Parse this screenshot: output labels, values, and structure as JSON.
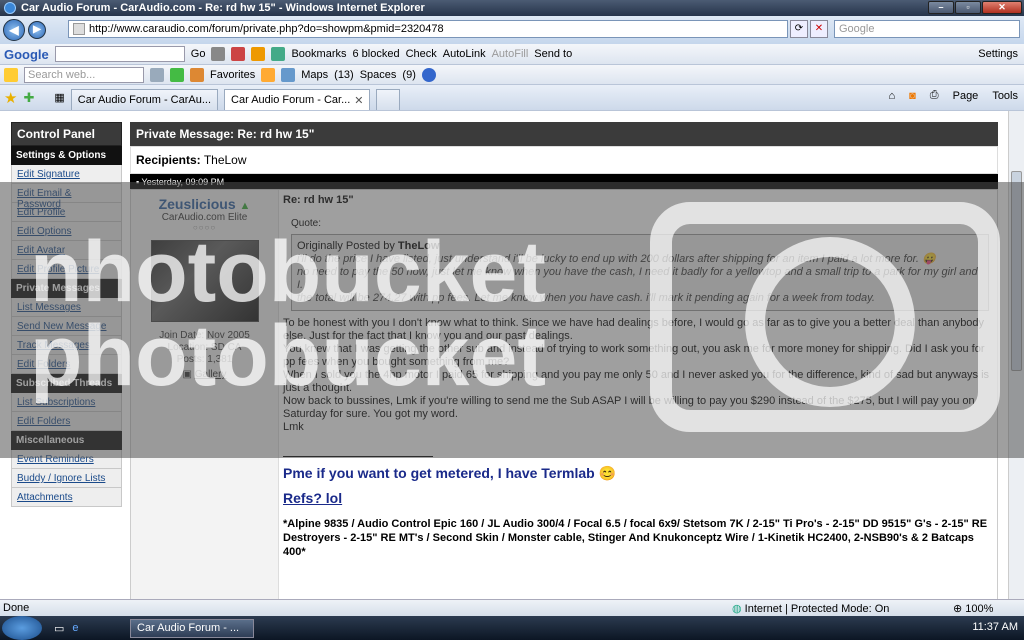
{
  "window": {
    "title": "Car Audio Forum - CarAudio.com - Re: rd hw 15\" - Windows Internet Explorer"
  },
  "address": {
    "url": "http://www.caraudio.com/forum/private.php?do=showpm&pmid=2320478",
    "search_placeholder": "Google"
  },
  "google_bar": {
    "brand": "Google",
    "go": "Go",
    "bookmarks": "Bookmarks",
    "blocked": "6 blocked",
    "check": "Check",
    "autolink": "AutoLink",
    "autofill": "AutoFill",
    "send_to": "Send to",
    "settings": "Settings"
  },
  "live_bar": {
    "search_placeholder": "Search web...",
    "favorites": "Favorites",
    "maps": "Maps",
    "mail_count": "(13)",
    "spaces": "Spaces",
    "msgr_count": "(9)"
  },
  "tabs": [
    {
      "label": "Car Audio Forum - CarAu..."
    },
    {
      "label": "Car Audio Forum - Car..."
    }
  ],
  "cmd": {
    "page": "Page",
    "tools": "Tools"
  },
  "sidebar": {
    "title": "Control Panel",
    "sections": [
      {
        "label": "Settings & Options",
        "items": [
          "Edit Signature",
          "Edit Email & Password",
          "Edit Profile",
          "Edit Options",
          "Edit Avatar",
          "Edit Profile Picture"
        ]
      },
      {
        "label": "Private Messages",
        "items": [
          "List Messages",
          "Send New Message",
          "Track Messages",
          "Edit Folders"
        ]
      },
      {
        "label": "Subscribed Threads",
        "items": [
          "List Subscriptions",
          "Edit Folders"
        ]
      },
      {
        "label": "Miscellaneous",
        "items": [
          "Event Reminders",
          "Buddy / Ignore Lists",
          "Attachments"
        ]
      }
    ]
  },
  "pm": {
    "header": "Private Message: Re: rd hw 15\"",
    "recipients_label": "Recipients:",
    "recipients": "TheLow",
    "date": "Yesterday, 09:09 PM",
    "user": {
      "name": "Zeuslicious",
      "title": "CarAudio.com Elite",
      "stars": "○○○○",
      "join": "Join Date: Nov 2005",
      "location": "Location: SD CA",
      "posts": "Posts: 1,381",
      "gallery": "Gallery"
    },
    "subject": "Re: rd hw 15\"",
    "quote_label": "Quote:",
    "quote_prefix": "Originally Posted by",
    "quote_author": "TheLow",
    "quote_lines": [
      "i'll do the price I have listed, just understand i'll be lucky to end up with 200 dollars after shipping for an item I paid a lot more for. 😛",
      "no need to pay the 50 now, just let me know when you have the cash, I need it badly for a yellowtop and a small trip to a park for my girl and I.",
      "the total will be 274.27 with pp fees. Let me know when you have cash. i'll mark it pending again for a week from today."
    ],
    "body_lines": [
      "To be honest with you I don't know what to think. Since we have had dealings before, I would go as far as to give you a better deal than anybody else. Just for the fact that I know you and our past dealings.",
      "You knew that I was getting the other sub and instead of trying to work something out, you ask me for more money for shipping. Did I ask you for pp fees when you bought something from me?",
      "When I sold you the 4hp motor I paid 65 for shipping and you pay me only 50 and I never asked you for the difference, kind of sad but anyways is just a thought.",
      "Now back to bussines, Lmk if you're willing to send me the Sub ASAP I will be willing to pay you $290 instead of the $275, but I will pay you on Saturday for sure. You got my word.",
      "Lmk"
    ],
    "sig": {
      "line1": "Pme if you want to get metered, I have Termlab 😊",
      "line2": "Refs? lol",
      "line3": "*Alpine 9835 / Audio Control Epic 160 / JL Audio 300/4 / Focal 6.5 / focal 6x9/ Stetsom 7K / 2-15\" Ti Pro's - 2-15\" DD 9515\" G's - 2-15\" RE Destroyers - 2-15\" RE MT's / Second Skin / Monster cable, Stinger And Knukonceptz Wire / 1-Kinetik HC2400, 2-NSB90's & 2 Batcaps 400*"
    }
  },
  "watermark": {
    "text1": "nhotobucket",
    "text2": "photobucket"
  },
  "status": {
    "left": "Done",
    "zone": "Internet | Protected Mode: On",
    "zoom": "100%"
  },
  "taskbar": {
    "task": "Car Audio Forum - ...",
    "clock": "11:37 AM"
  }
}
